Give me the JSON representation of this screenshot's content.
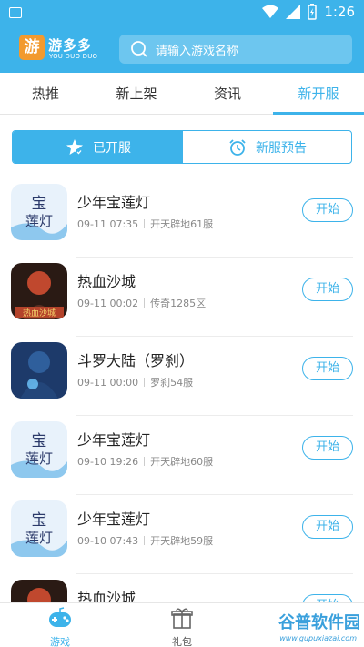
{
  "status_bar": {
    "time": "1:26"
  },
  "header": {
    "logo_char": "游",
    "app_name": "游多多",
    "app_sub": "YOU DUO DUO",
    "search": {
      "placeholder": "请输入游戏名称"
    }
  },
  "tabs": [
    {
      "label": "热推"
    },
    {
      "label": "新上架"
    },
    {
      "label": "资讯"
    },
    {
      "label": "新开服",
      "active": true
    }
  ],
  "segment": {
    "opened_label": "已开服",
    "preview_label": "新服预告"
  },
  "games": [
    {
      "name": "少年宝莲灯",
      "time": "09-11 07:35",
      "server": "开天辟地61服",
      "button": "开始",
      "icon": "baolian-icon"
    },
    {
      "name": "热血沙城",
      "time": "09-11 00:02",
      "server": "传奇1285区",
      "button": "开始",
      "icon": "shacheng-icon"
    },
    {
      "name": "斗罗大陆（罗刹）",
      "time": "09-11 00:00",
      "server": "罗刹54服",
      "button": "开始",
      "icon": "douluo-icon"
    },
    {
      "name": "少年宝莲灯",
      "time": "09-10 19:26",
      "server": "开天辟地60服",
      "button": "开始",
      "icon": "baolian-icon"
    },
    {
      "name": "少年宝莲灯",
      "time": "09-10 07:43",
      "server": "开天辟地59服",
      "button": "开始",
      "icon": "baolian-icon"
    },
    {
      "name": "热血沙城",
      "time": "",
      "server": "",
      "button": "开始",
      "icon": "shacheng-icon"
    }
  ],
  "bottom_nav": [
    {
      "label": "游戏",
      "active": true
    },
    {
      "label": "礼包"
    }
  ],
  "watermark": {
    "main": "谷普软件园",
    "sub": "www.gupuxiazai.com"
  },
  "colors": {
    "primary": "#3db3ea",
    "text": "#222222",
    "muted": "#888888"
  }
}
